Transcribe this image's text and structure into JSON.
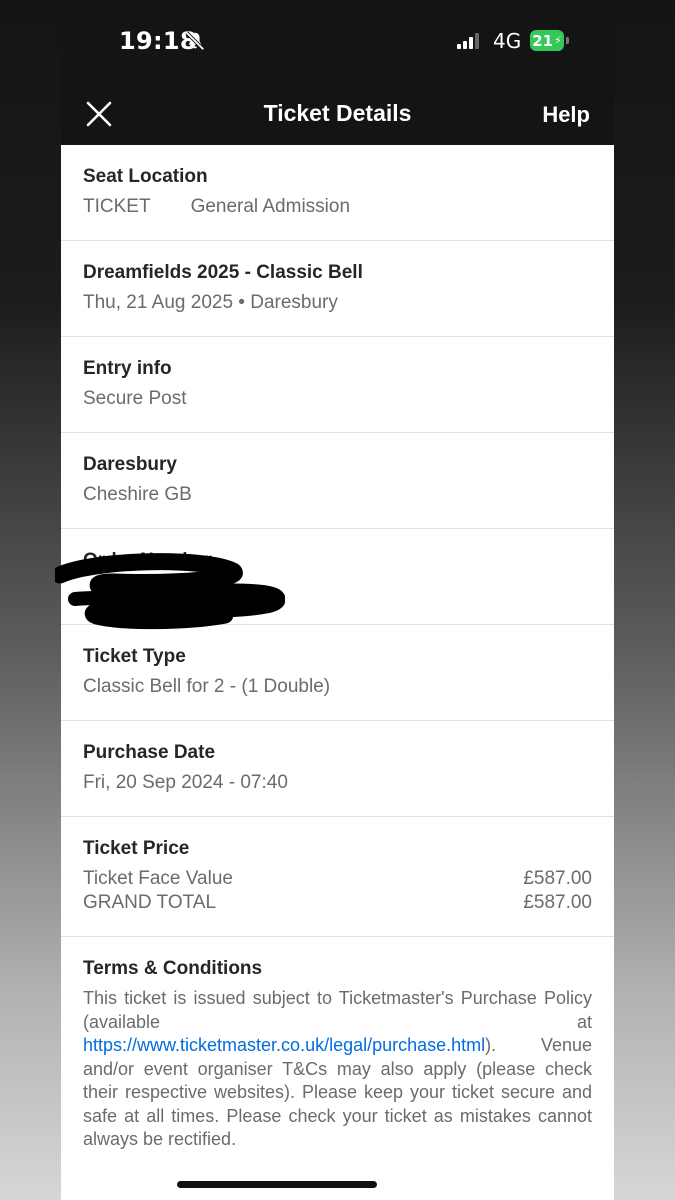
{
  "status_bar": {
    "time": "19:18",
    "network": "4G",
    "battery": "21",
    "icons": [
      "bell-slash-icon",
      "signal-icon",
      "battery-charging-icon"
    ]
  },
  "nav": {
    "title": "Ticket Details",
    "help": "Help",
    "close_icon": "close-icon"
  },
  "seat": {
    "heading": "Seat Location",
    "label": "TICKET",
    "value": "General Admission"
  },
  "event": {
    "name": "Dreamfields 2025 - Classic Bell",
    "details": "Thu, 21 Aug 2025 • Daresbury"
  },
  "entry": {
    "heading": "Entry info",
    "value": "Secure Post"
  },
  "venue": {
    "heading": "Daresbury",
    "value": "Cheshire GB"
  },
  "order": {
    "heading": "Order Number"
  },
  "ticket_type": {
    "heading": "Ticket Type",
    "value": "Classic Bell for 2 - (1 Double)"
  },
  "purchase": {
    "heading": "Purchase Date",
    "value": "Fri, 20 Sep 2024 - 07:40"
  },
  "price": {
    "heading": "Ticket Price",
    "face_label": "Ticket Face Value",
    "face_value": "£587.00",
    "total_label": "GRAND TOTAL",
    "total_value": "£587.00"
  },
  "terms": {
    "heading": "Terms & Conditions",
    "text_before": "This ticket is issued subject to Ticketmaster's Purchase Policy (available at ",
    "link": "https://www.ticketmaster.co.uk/legal/purchase.html",
    "text_after": "). Venue and/or event organiser T&Cs may also apply (please check their respective websites). Please keep your ticket secure and safe at all times. Please check your ticket as mistakes cannot always be rectified."
  },
  "colors": {
    "header_bg": "#141414",
    "link": "#026cdf",
    "battery": "#35c759"
  }
}
